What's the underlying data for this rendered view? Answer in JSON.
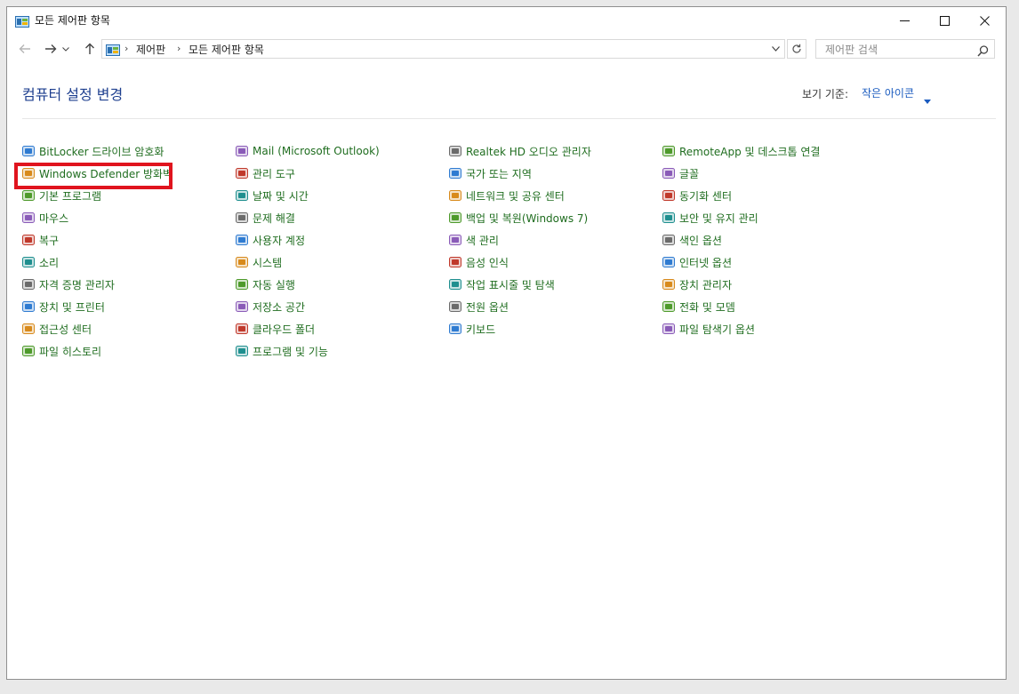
{
  "window": {
    "title": "모든 제어판 항목"
  },
  "nav": {
    "breadcrumbs": [
      "제어판",
      "모든 제어판 항목"
    ],
    "search_placeholder": "제어판 검색"
  },
  "content": {
    "heading": "컴퓨터 설정 변경",
    "view_by_label": "보기 기준:",
    "view_by_value": "작은 아이콘",
    "highlight_color": "#e0141e",
    "link_color": "#1f6d1f",
    "columns": [
      [
        {
          "label": "BitLocker 드라이브 암호화",
          "icon": "bitlocker-icon"
        },
        {
          "label": "Windows Defender 방화벽",
          "icon": "firewall-icon",
          "highlighted": true
        },
        {
          "label": "기본 프로그램",
          "icon": "default-programs-icon"
        },
        {
          "label": "마우스",
          "icon": "mouse-icon"
        },
        {
          "label": "복구",
          "icon": "recovery-icon"
        },
        {
          "label": "소리",
          "icon": "sound-icon"
        },
        {
          "label": "자격 증명 관리자",
          "icon": "credential-manager-icon"
        },
        {
          "label": "장치 및 프린터",
          "icon": "devices-printers-icon"
        },
        {
          "label": "접근성 센터",
          "icon": "ease-of-access-icon"
        },
        {
          "label": "파일 히스토리",
          "icon": "file-history-icon"
        }
      ],
      [
        {
          "label": "Mail (Microsoft Outlook)",
          "icon": "mail-icon"
        },
        {
          "label": "관리 도구",
          "icon": "admin-tools-icon"
        },
        {
          "label": "날짜 및 시간",
          "icon": "date-time-icon"
        },
        {
          "label": "문제 해결",
          "icon": "troubleshooting-icon"
        },
        {
          "label": "사용자 계정",
          "icon": "user-accounts-icon"
        },
        {
          "label": "시스템",
          "icon": "system-icon"
        },
        {
          "label": "자동 실행",
          "icon": "autoplay-icon"
        },
        {
          "label": "저장소 공간",
          "icon": "storage-spaces-icon"
        },
        {
          "label": "클라우드 폴더",
          "icon": "work-folders-icon"
        },
        {
          "label": "프로그램 및 기능",
          "icon": "programs-features-icon"
        }
      ],
      [
        {
          "label": "Realtek HD 오디오 관리자",
          "icon": "realtek-audio-icon"
        },
        {
          "label": "국가 또는 지역",
          "icon": "region-icon"
        },
        {
          "label": "네트워크 및 공유 센터",
          "icon": "network-sharing-icon"
        },
        {
          "label": "백업 및 복원(Windows 7)",
          "icon": "backup-restore-icon"
        },
        {
          "label": "색 관리",
          "icon": "color-management-icon"
        },
        {
          "label": "음성 인식",
          "icon": "speech-recognition-icon"
        },
        {
          "label": "작업 표시줄 및 탐색",
          "icon": "taskbar-navigation-icon"
        },
        {
          "label": "전원 옵션",
          "icon": "power-options-icon"
        },
        {
          "label": "키보드",
          "icon": "keyboard-icon"
        }
      ],
      [
        {
          "label": "RemoteApp 및 데스크톱 연결",
          "icon": "remoteapp-icon"
        },
        {
          "label": "글꼴",
          "icon": "fonts-icon"
        },
        {
          "label": "동기화 센터",
          "icon": "sync-center-icon"
        },
        {
          "label": "보안 및 유지 관리",
          "icon": "security-maintenance-icon"
        },
        {
          "label": "색인 옵션",
          "icon": "indexing-options-icon"
        },
        {
          "label": "인터넷 옵션",
          "icon": "internet-options-icon"
        },
        {
          "label": "장치 관리자",
          "icon": "device-manager-icon"
        },
        {
          "label": "전화 및 모뎀",
          "icon": "phone-modem-icon"
        },
        {
          "label": "파일 탐색기 옵션",
          "icon": "file-explorer-options-icon"
        }
      ]
    ]
  }
}
